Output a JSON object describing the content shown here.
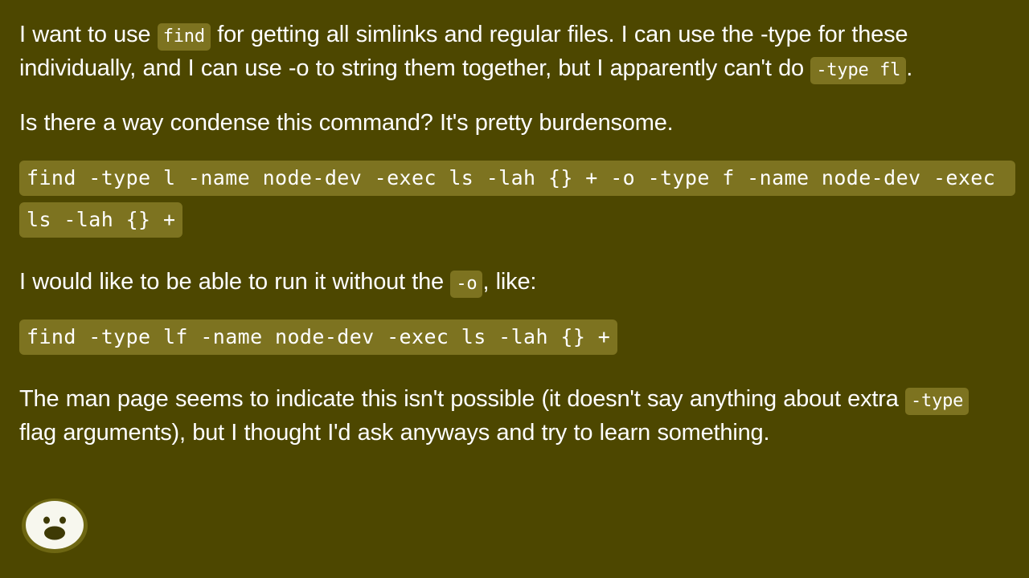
{
  "theme": {
    "background": "#4d4700",
    "text_color": "#ffffff",
    "code_background": "#7d7320"
  },
  "post": {
    "paragraph_1": {
      "segment_1": "I want to use ",
      "code_1": "find",
      "segment_2": " for getting all simlinks and regular files. I can use the -type for these individually, and I can use -o to string them together, but I apparently can't do ",
      "code_2": "-type fl",
      "segment_3": "."
    },
    "paragraph_2": {
      "text": "Is there a way condense this command? It's pretty burdensome."
    },
    "code_block_1": {
      "text": "find -type l -name node-dev -exec ls -lah {} + -o -type f -name node-dev -exec ls -lah {} +"
    },
    "paragraph_3": {
      "segment_1": "I would like to be able to run it without the ",
      "code_1": "-o",
      "segment_2": ", like:"
    },
    "code_block_2": {
      "text": "find -type lf -name node-dev -exec ls -lah {} +"
    },
    "paragraph_4": {
      "segment_1": "The man page seems to indicate this isn't possible (it doesn't say anything about extra ",
      "code_1": "-type",
      "segment_2": " flag arguments), but I thought I'd ask anyways and try to learn something."
    }
  },
  "avatar": {
    "icon": "surprised-face-avatar"
  }
}
